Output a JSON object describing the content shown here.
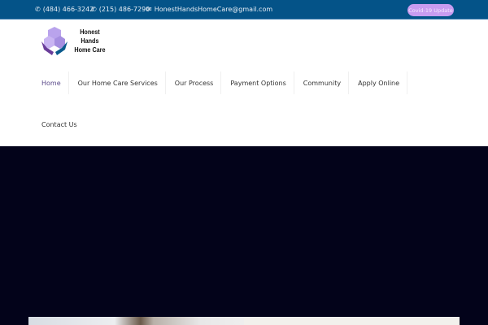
{
  "topbar": {
    "phone1": "(484) 466-3242",
    "phone2": "(215) 486-7290",
    "email": "HonestHandsHomeCare@gmail.com",
    "covid_button": "Covid-19 Update",
    "icons": {
      "phone": "phone-icon",
      "email": "envelope-icon"
    }
  },
  "logo": {
    "line1": "Honest",
    "line2": "Hands",
    "line3": "Home Care"
  },
  "nav": {
    "items": [
      {
        "label": "Home"
      },
      {
        "label": "Our Home Care Services"
      },
      {
        "label": "Our Process"
      },
      {
        "label": "Payment Options"
      },
      {
        "label": "Community"
      },
      {
        "label": "Apply Online"
      }
    ],
    "contact": "Contact Us"
  },
  "colors": {
    "topbar": "#045388",
    "hero": "#03031a",
    "accent": "#c89cf0"
  }
}
